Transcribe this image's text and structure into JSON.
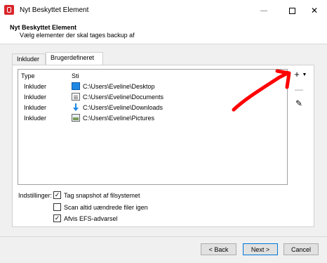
{
  "window": {
    "title": "Nyt Beskyttet Element"
  },
  "header": {
    "title": "Nyt Beskyttet Element",
    "subtitle": "Vælg elementer der skal tages backup af"
  },
  "tabs": [
    {
      "label": "Inkluder"
    },
    {
      "label": "Brugerdefineret"
    }
  ],
  "list": {
    "columns": [
      "Type",
      "Sti"
    ],
    "rows": [
      {
        "type": "Inkluder",
        "path": "C:\\Users\\Eveline\\Desktop",
        "icon": "desktop-folder-icon"
      },
      {
        "type": "Inkluder",
        "path": "C:\\Users\\Eveline\\Documents",
        "icon": "documents-folder-icon"
      },
      {
        "type": "Inkluder",
        "path": "C:\\Users\\Eveline\\Downloads",
        "icon": "downloads-folder-icon"
      },
      {
        "type": "Inkluder",
        "path": "C:\\Users\\Eveline\\Pictures",
        "icon": "pictures-folder-icon"
      }
    ]
  },
  "side_buttons": {
    "add": "+",
    "add_arrow": "▼",
    "remove": "—",
    "edit": "✎"
  },
  "settings": {
    "label": "Indstillinger:",
    "options": [
      {
        "label": "Tag snapshot af filsystemet",
        "checked": true,
        "mark": "✓"
      },
      {
        "label": "Scan altid uændrede filer igen",
        "checked": false,
        "mark": ""
      },
      {
        "label": "Afvis EFS-advarsel",
        "checked": true,
        "mark": "✓"
      }
    ]
  },
  "footer": {
    "back": "< Back",
    "next": "Next >",
    "cancel": "Cancel"
  },
  "colors": {
    "annotation": "#ff0000",
    "accent": "#0078d7"
  }
}
